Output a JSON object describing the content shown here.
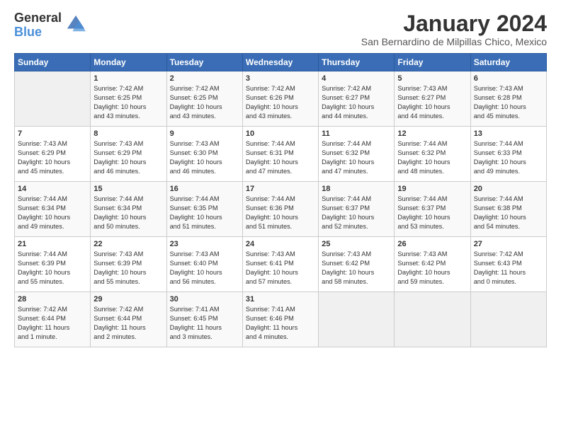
{
  "logo": {
    "general": "General",
    "blue": "Blue"
  },
  "header": {
    "month_year": "January 2024",
    "location": "San Bernardino de Milpillas Chico, Mexico"
  },
  "days_of_week": [
    "Sunday",
    "Monday",
    "Tuesday",
    "Wednesday",
    "Thursday",
    "Friday",
    "Saturday"
  ],
  "weeks": [
    [
      {
        "day": "",
        "info": ""
      },
      {
        "day": "1",
        "info": "Sunrise: 7:42 AM\nSunset: 6:25 PM\nDaylight: 10 hours\nand 43 minutes."
      },
      {
        "day": "2",
        "info": "Sunrise: 7:42 AM\nSunset: 6:25 PM\nDaylight: 10 hours\nand 43 minutes."
      },
      {
        "day": "3",
        "info": "Sunrise: 7:42 AM\nSunset: 6:26 PM\nDaylight: 10 hours\nand 43 minutes."
      },
      {
        "day": "4",
        "info": "Sunrise: 7:42 AM\nSunset: 6:27 PM\nDaylight: 10 hours\nand 44 minutes."
      },
      {
        "day": "5",
        "info": "Sunrise: 7:43 AM\nSunset: 6:27 PM\nDaylight: 10 hours\nand 44 minutes."
      },
      {
        "day": "6",
        "info": "Sunrise: 7:43 AM\nSunset: 6:28 PM\nDaylight: 10 hours\nand 45 minutes."
      }
    ],
    [
      {
        "day": "7",
        "info": "Sunrise: 7:43 AM\nSunset: 6:29 PM\nDaylight: 10 hours\nand 45 minutes."
      },
      {
        "day": "8",
        "info": "Sunrise: 7:43 AM\nSunset: 6:29 PM\nDaylight: 10 hours\nand 46 minutes."
      },
      {
        "day": "9",
        "info": "Sunrise: 7:43 AM\nSunset: 6:30 PM\nDaylight: 10 hours\nand 46 minutes."
      },
      {
        "day": "10",
        "info": "Sunrise: 7:44 AM\nSunset: 6:31 PM\nDaylight: 10 hours\nand 47 minutes."
      },
      {
        "day": "11",
        "info": "Sunrise: 7:44 AM\nSunset: 6:32 PM\nDaylight: 10 hours\nand 47 minutes."
      },
      {
        "day": "12",
        "info": "Sunrise: 7:44 AM\nSunset: 6:32 PM\nDaylight: 10 hours\nand 48 minutes."
      },
      {
        "day": "13",
        "info": "Sunrise: 7:44 AM\nSunset: 6:33 PM\nDaylight: 10 hours\nand 49 minutes."
      }
    ],
    [
      {
        "day": "14",
        "info": "Sunrise: 7:44 AM\nSunset: 6:34 PM\nDaylight: 10 hours\nand 49 minutes."
      },
      {
        "day": "15",
        "info": "Sunrise: 7:44 AM\nSunset: 6:34 PM\nDaylight: 10 hours\nand 50 minutes."
      },
      {
        "day": "16",
        "info": "Sunrise: 7:44 AM\nSunset: 6:35 PM\nDaylight: 10 hours\nand 51 minutes."
      },
      {
        "day": "17",
        "info": "Sunrise: 7:44 AM\nSunset: 6:36 PM\nDaylight: 10 hours\nand 51 minutes."
      },
      {
        "day": "18",
        "info": "Sunrise: 7:44 AM\nSunset: 6:37 PM\nDaylight: 10 hours\nand 52 minutes."
      },
      {
        "day": "19",
        "info": "Sunrise: 7:44 AM\nSunset: 6:37 PM\nDaylight: 10 hours\nand 53 minutes."
      },
      {
        "day": "20",
        "info": "Sunrise: 7:44 AM\nSunset: 6:38 PM\nDaylight: 10 hours\nand 54 minutes."
      }
    ],
    [
      {
        "day": "21",
        "info": "Sunrise: 7:44 AM\nSunset: 6:39 PM\nDaylight: 10 hours\nand 55 minutes."
      },
      {
        "day": "22",
        "info": "Sunrise: 7:43 AM\nSunset: 6:39 PM\nDaylight: 10 hours\nand 55 minutes."
      },
      {
        "day": "23",
        "info": "Sunrise: 7:43 AM\nSunset: 6:40 PM\nDaylight: 10 hours\nand 56 minutes."
      },
      {
        "day": "24",
        "info": "Sunrise: 7:43 AM\nSunset: 6:41 PM\nDaylight: 10 hours\nand 57 minutes."
      },
      {
        "day": "25",
        "info": "Sunrise: 7:43 AM\nSunset: 6:42 PM\nDaylight: 10 hours\nand 58 minutes."
      },
      {
        "day": "26",
        "info": "Sunrise: 7:43 AM\nSunset: 6:42 PM\nDaylight: 10 hours\nand 59 minutes."
      },
      {
        "day": "27",
        "info": "Sunrise: 7:42 AM\nSunset: 6:43 PM\nDaylight: 11 hours\nand 0 minutes."
      }
    ],
    [
      {
        "day": "28",
        "info": "Sunrise: 7:42 AM\nSunset: 6:44 PM\nDaylight: 11 hours\nand 1 minute."
      },
      {
        "day": "29",
        "info": "Sunrise: 7:42 AM\nSunset: 6:44 PM\nDaylight: 11 hours\nand 2 minutes."
      },
      {
        "day": "30",
        "info": "Sunrise: 7:41 AM\nSunset: 6:45 PM\nDaylight: 11 hours\nand 3 minutes."
      },
      {
        "day": "31",
        "info": "Sunrise: 7:41 AM\nSunset: 6:46 PM\nDaylight: 11 hours\nand 4 minutes."
      },
      {
        "day": "",
        "info": ""
      },
      {
        "day": "",
        "info": ""
      },
      {
        "day": "",
        "info": ""
      }
    ]
  ]
}
